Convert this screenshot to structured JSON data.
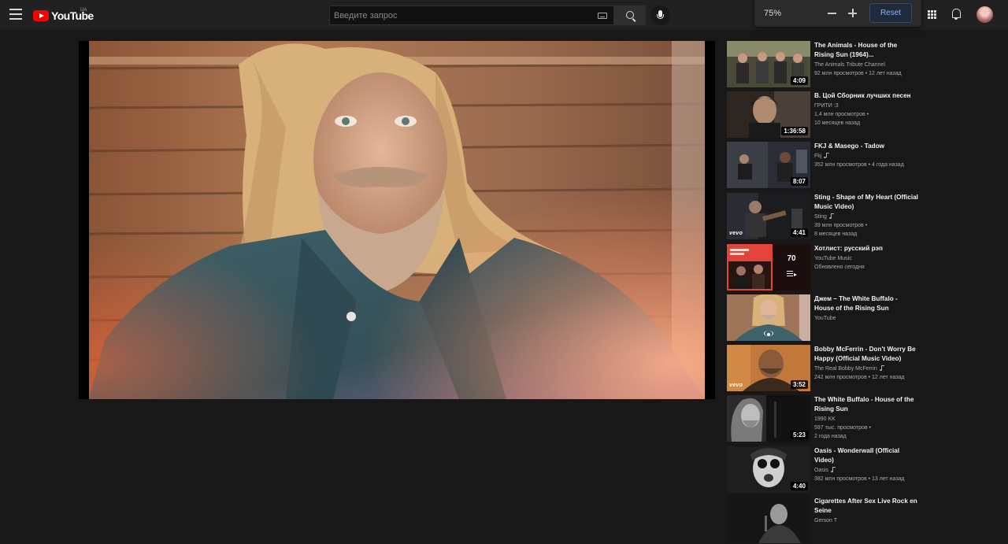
{
  "header": {
    "logo_text": "YouTube",
    "region": "UA",
    "search_placeholder": "Введите запрос"
  },
  "zoom": {
    "level": "75%",
    "reset_label": "Reset"
  },
  "player": {
    "title": "Джем – The White Buffalo - House of the Rising Sun"
  },
  "recommendations": [
    {
      "title": "The Animals - House of the Rising Sun (1964)...",
      "channel": "The Animals Tribute Channel",
      "stats": "92 млн просмотров • 12 лет назад",
      "duration": "4:09"
    },
    {
      "title": "В. Цой Сборник лучших песен",
      "channel": "ГРИТИ :3",
      "stats": "1,4 млн просмотров •",
      "stats2": "10 месяцев назад",
      "duration": "1:36:58"
    },
    {
      "title": "FKJ & Masego - Tadow",
      "channel": "Fkj",
      "stats": "352 млн просмотров • 4 года назад",
      "duration": "8:07",
      "music": true
    },
    {
      "title": "Sting - Shape of My Heart (Official Music Video)",
      "channel": "Sting",
      "stats": "39 млн просмотров •",
      "stats2": "8 месяцев назад",
      "duration": "4:41",
      "music": true,
      "vevo": "vevo"
    },
    {
      "title": "Хотлист: русский рэп",
      "channel": "YouTube Music",
      "stats": "Обновлено сегодня",
      "playlist_count": "70"
    },
    {
      "title": "Джем – The White Buffalo - House of the Rising Sun",
      "channel": "YouTube",
      "stats": ""
    },
    {
      "title": "Bobby McFerrin - Don't Worry Be Happy (Official Music Video)",
      "channel": "The Real Bobby McFerrin",
      "stats": "242 млн просмотров • 12 лет назад",
      "duration": "3:52",
      "music": true,
      "vevo": "vevo"
    },
    {
      "title": "The White Buffalo - House of the Rising Sun",
      "channel": "1990 KK",
      "stats": "597 тыс. просмотров •",
      "stats2": "2 года назад",
      "duration": "5:23"
    },
    {
      "title": "Oasis - Wonderwall (Official Video)",
      "channel": "Oasis",
      "stats": "382 млн просмотров • 13 лет назад",
      "duration": "4:40",
      "music": true
    },
    {
      "title": "Cigarettes After Sex Live Rock en Seine",
      "channel": "Gerson T",
      "stats": ""
    }
  ],
  "icons": [
    "menu-icon",
    "youtube-logo-icon",
    "keyboard-icon",
    "search-icon",
    "microphone-icon",
    "zoom-out-icon",
    "zoom-in-icon",
    "apps-grid-icon",
    "notifications-bell-icon",
    "playlist-play-icon",
    "live-icon",
    "music-note-icon"
  ],
  "colors": {
    "background": "#181818",
    "topbar": "#212121",
    "brand_red": "#ff0000",
    "reset_accent": "#8ab4f8"
  }
}
